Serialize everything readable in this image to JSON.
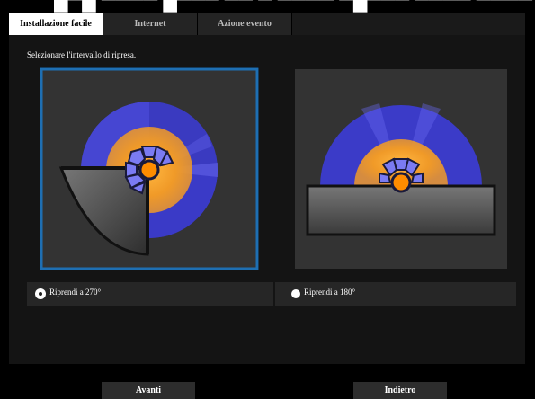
{
  "tabs": [
    {
      "label": "Installazione facile",
      "active": true
    },
    {
      "label": "Internet",
      "active": false
    },
    {
      "label": "Azione evento",
      "active": false
    }
  ],
  "instruction": "Selezionare l'intervallo di ripresa.",
  "options": [
    {
      "label": "Riprendi a 270°",
      "selected": true,
      "icon": "camera-270-illustration"
    },
    {
      "label": "Riprendi a 180°",
      "selected": false,
      "icon": "camera-180-illustration"
    }
  ],
  "buttons": {
    "next": "Avanti",
    "back": "Indietro"
  },
  "colors": {
    "selection_border": "#1e6fb3",
    "coverage_blue": "#3a3ad6",
    "coverage_orange": "#f5a01e",
    "camera_icon": "#7b7bf2",
    "lens": "#ff8c00"
  }
}
